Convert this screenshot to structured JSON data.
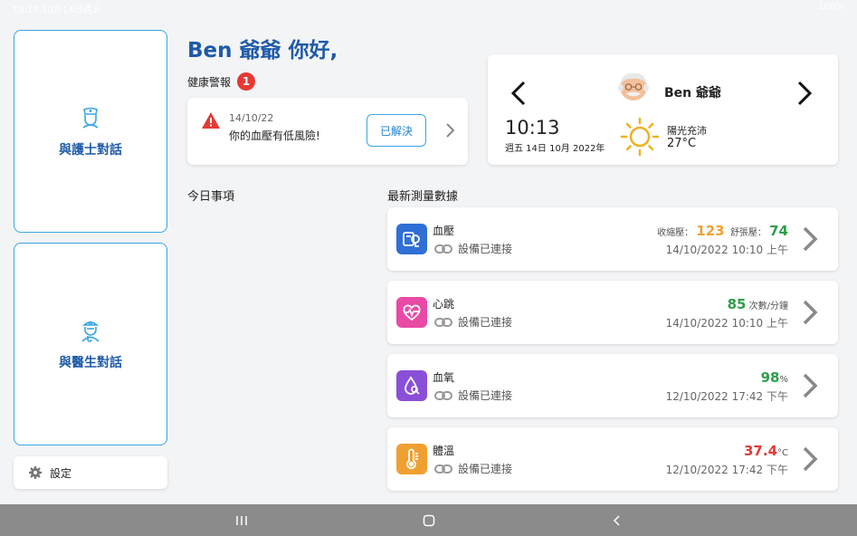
{
  "status": {
    "time": "10:13 10月14日週五",
    "battery": "100%"
  },
  "sidebar": {
    "nurse_label": "與護士對話",
    "doctor_label": "與醫生對話",
    "settings_label": "設定"
  },
  "greeting": "Ben 爺爺 你好,",
  "health_alerts": {
    "title": "健康警報",
    "count": "1",
    "date": "14/10/22",
    "message": "你的血壓有低風險!",
    "resolve_label": "已解決"
  },
  "profile": {
    "name": "Ben 爺爺",
    "time": "10:13",
    "date": "週五 14日 10月 2022年",
    "weather": "陽光充沛",
    "temperature": "27°C"
  },
  "sections": {
    "today": "今日事項",
    "latest": "最新測量數據"
  },
  "measurements": [
    {
      "name": "血壓",
      "connection": "設備已連接",
      "systolic_label": "收縮壓：",
      "systolic": "123",
      "diastolic_label": "舒張壓：",
      "diastolic": "74",
      "timestamp": "14/10/2022  10:10 上午",
      "icon": "blood-pressure-icon",
      "icon_color": "#2f6fd6"
    },
    {
      "name": "心跳",
      "connection": "設備已連接",
      "value": "85",
      "unit": "次數/分鐘",
      "timestamp": "14/10/2022  10:10 上午",
      "icon": "heart-rate-icon",
      "icon_color": "#e84aa5"
    },
    {
      "name": "血氧",
      "connection": "設備已連接",
      "value": "98",
      "unit": "%",
      "timestamp": "12/10/2022  17:42 下午",
      "icon": "blood-oxygen-icon",
      "icon_color": "#8a4fd8"
    },
    {
      "name": "體溫",
      "connection": "設備已連接",
      "value": "37.4",
      "unit": "°C",
      "timestamp": "12/10/2022  17:42 下午",
      "icon": "thermometer-icon",
      "icon_color": "#f0a030"
    }
  ],
  "colors": {
    "brand": "#1e5aa8",
    "accent": "#3aa5e0",
    "orange": "#f0a030",
    "green": "#2e9e4a",
    "red": "#e53935"
  }
}
